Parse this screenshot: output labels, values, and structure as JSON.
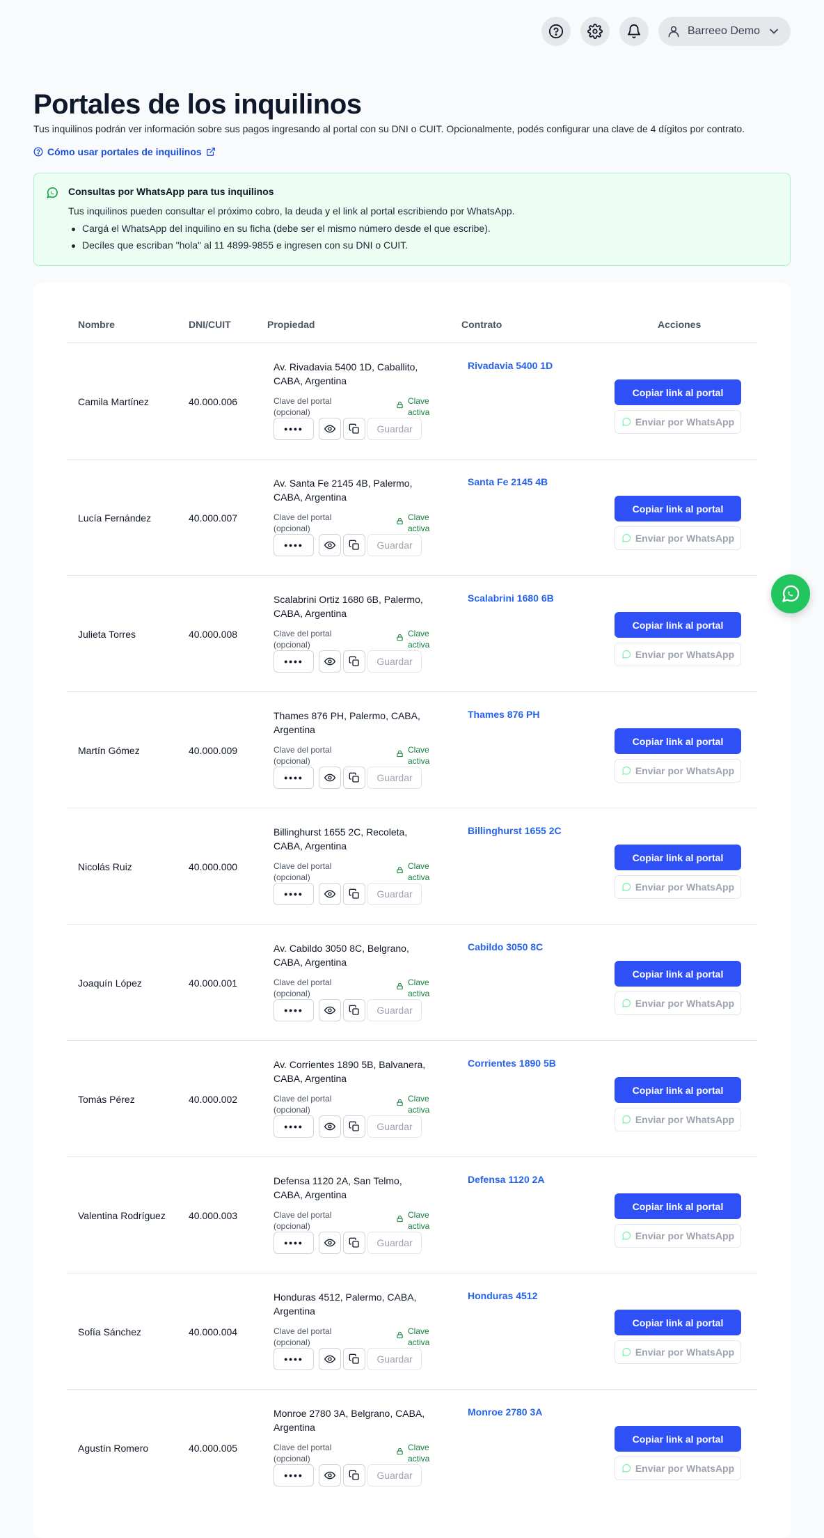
{
  "topbar": {
    "user_name": "Barreeo Demo",
    "icons": [
      "help-icon",
      "gear-icon",
      "bell-icon",
      "user-icon",
      "chevron-down-icon"
    ]
  },
  "header": {
    "title": "Portales de los inquilinos",
    "subtitle": "Tus inquilinos podrán ver información sobre sus pagos ingresando al portal con su DNI o CUIT. Opcionalmente, podés configurar una clave de 4 dígitos por contrato.",
    "help_link": "Cómo usar portales de inquilinos"
  },
  "whatsapp_info": {
    "title": "Consultas por WhatsApp para tus inquilinos",
    "description": "Tus inquilinos pueden consultar el próximo cobro, la deuda y el link al portal escribiendo por WhatsApp.",
    "bullets": [
      "Cargá el WhatsApp del inquilino en su ficha (debe ser el mismo número desde el que escribe).",
      "Decíles que escriban \"hola\" al 11 4899-9855 e ingresen con su DNI o CUIT."
    ]
  },
  "table": {
    "headers": {
      "name": "Nombre",
      "dni": "DNI/CUIT",
      "property": "Propiedad",
      "contract": "Contrato",
      "actions": "Acciones"
    },
    "key_label": "Clave del portal (opcional)",
    "key_status": "Clave activa",
    "pin_mask": "••••",
    "save_label": "Guardar",
    "copy_link_label": "Copiar link al portal",
    "whatsapp_label": "Enviar por WhatsApp",
    "rows": [
      {
        "name": "Camila Martínez",
        "dni": "40.000.006",
        "address": "Av. Rivadavia 5400 1D, Caballito, CABA, Argentina",
        "contract": "Rivadavia 5400 1D"
      },
      {
        "name": "Lucía Fernández",
        "dni": "40.000.007",
        "address": "Av. Santa Fe 2145 4B, Palermo, CABA, Argentina",
        "contract": "Santa Fe 2145 4B"
      },
      {
        "name": "Julieta Torres",
        "dni": "40.000.008",
        "address": "Scalabrini Ortiz 1680 6B, Palermo, CABA, Argentina",
        "contract": "Scalabrini 1680 6B"
      },
      {
        "name": "Martín Gómez",
        "dni": "40.000.009",
        "address": "Thames 876 PH, Palermo, CABA, Argentina",
        "contract": "Thames 876 PH"
      },
      {
        "name": "Nicolás Ruiz",
        "dni": "40.000.000",
        "address": "Billinghurst 1655 2C, Recoleta, CABA, Argentina",
        "contract": "Billinghurst 1655 2C"
      },
      {
        "name": "Joaquín López",
        "dni": "40.000.001",
        "address": "Av. Cabildo 3050 8C, Belgrano, CABA, Argentina",
        "contract": "Cabildo 3050 8C"
      },
      {
        "name": "Tomás Pérez",
        "dni": "40.000.002",
        "address": "Av. Corrientes 1890 5B, Balvanera, CABA, Argentina",
        "contract": "Corrientes 1890 5B"
      },
      {
        "name": "Valentina Rodríguez",
        "dni": "40.000.003",
        "address": "Defensa 1120 2A, San Telmo, CABA, Argentina",
        "contract": "Defensa 1120 2A"
      },
      {
        "name": "Sofía Sánchez",
        "dni": "40.000.004",
        "address": "Honduras 4512, Palermo, CABA, Argentina",
        "contract": "Honduras 4512"
      },
      {
        "name": "Agustín Romero",
        "dni": "40.000.005",
        "address": "Monroe 2780 3A, Belgrano, CABA, Argentina",
        "contract": "Monroe 2780 3A"
      }
    ]
  },
  "colors": {
    "primary": "#2f4ff7",
    "link": "#2563eb",
    "success": "#15803d",
    "whatsapp": "#22c55e",
    "info_bg": "#ecfdf3"
  }
}
